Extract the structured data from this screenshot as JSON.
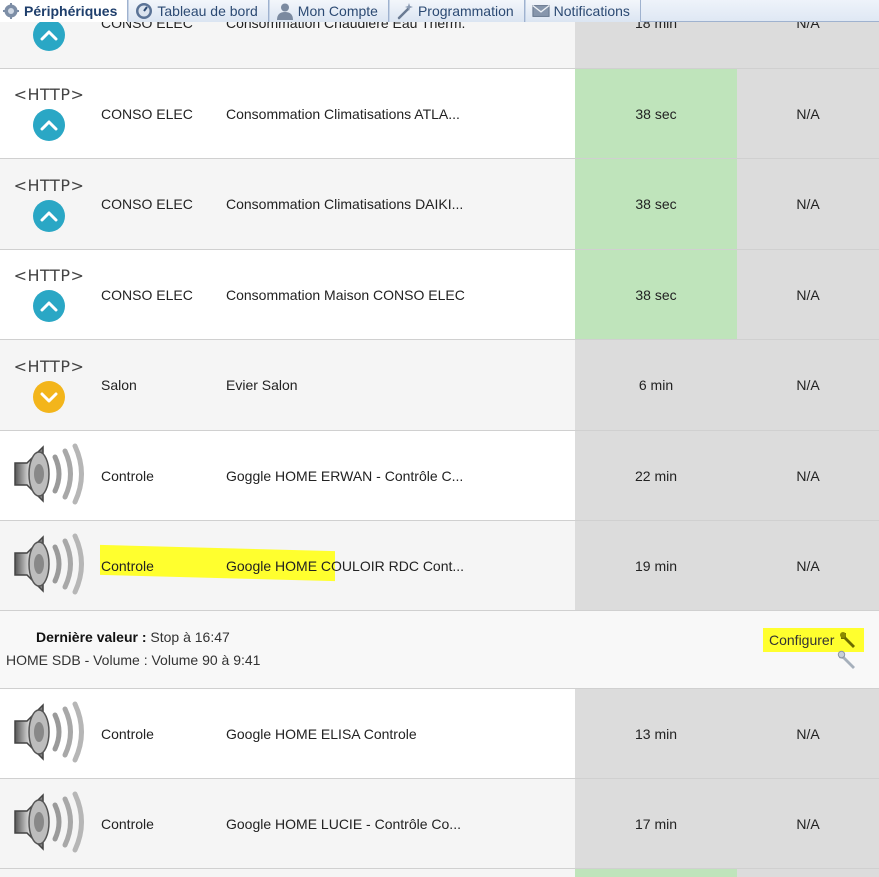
{
  "tabs": [
    {
      "label": "Périphériques",
      "icon": "devices-icon",
      "active": true
    },
    {
      "label": "Tableau de bord",
      "icon": "dashboard-icon",
      "active": false
    },
    {
      "label": "Mon Compte",
      "icon": "user-icon",
      "active": false
    },
    {
      "label": "Programmation",
      "icon": "wand-icon",
      "active": false
    },
    {
      "label": "Notifications",
      "icon": "mail-icon",
      "active": false
    }
  ],
  "rows": [
    {
      "icon": "http",
      "arrow": "up",
      "room": "CONSO ELEC",
      "name": "Consommation Chaudière Eau Therm...",
      "last": "18 min",
      "value": "N/A",
      "last_ok": false
    },
    {
      "icon": "http",
      "arrow": "up",
      "room": "CONSO ELEC",
      "name": "Consommation Climatisations ATLA...",
      "last": "38 sec",
      "value": "N/A",
      "last_ok": true
    },
    {
      "icon": "http",
      "arrow": "up",
      "room": "CONSO ELEC",
      "name": "Consommation Climatisations DAIKI...",
      "last": "38 sec",
      "value": "N/A",
      "last_ok": true
    },
    {
      "icon": "http",
      "arrow": "up",
      "room": "CONSO ELEC",
      "name": "Consommation Maison CONSO ELEC",
      "last": "38 sec",
      "value": "N/A",
      "last_ok": true
    },
    {
      "icon": "http",
      "arrow": "down",
      "room": "Salon",
      "name": "Evier Salon",
      "last": "6 min",
      "value": "N/A",
      "last_ok": false
    },
    {
      "icon": "speaker",
      "room": "Controle",
      "name": "Goggle HOME ERWAN - Contrôle C...",
      "last": "22 min",
      "value": "N/A",
      "last_ok": false
    },
    {
      "icon": "speaker",
      "room": "Controle",
      "name": "Google HOME COULOIR RDC Cont...",
      "last": "19 min",
      "value": "N/A",
      "last_ok": false,
      "highlighted": true
    },
    {
      "icon": "speaker",
      "room": "Controle",
      "name": "Google HOME ELISA Controle",
      "last": "13 min",
      "value": "N/A",
      "last_ok": false
    },
    {
      "icon": "speaker",
      "room": "Controle",
      "name": "Google HOME LUCIE - Contrôle Co...",
      "last": "17 min",
      "value": "N/A",
      "last_ok": false
    }
  ],
  "http_label": "<HTTP>",
  "details": {
    "last_value_label": "Dernière valeur :",
    "last_value": "Stop à 16:47",
    "volume_line": "HOME SDB - Volume : Volume 90 à 9:41",
    "configure_label": "Configurer"
  },
  "colors": {
    "accent_blue": "#2aa7c5",
    "accent_yellow": "#f3b51b",
    "ok_green": "#bfe4bb",
    "neutral_grey": "#dcdcdc",
    "highlight": "#ffff2e"
  }
}
